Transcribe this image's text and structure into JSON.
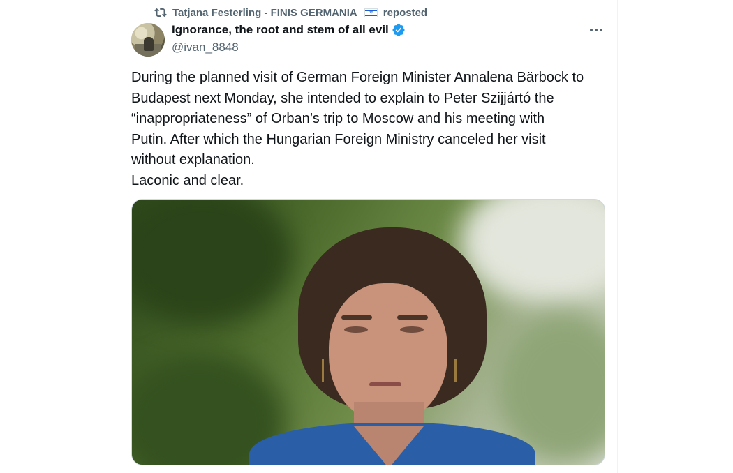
{
  "repost": {
    "user": "Tatjana Festerling - FINIS GERMANIA",
    "flag": "🇮🇱",
    "label": "reposted"
  },
  "tweet": {
    "author_name": "Ignorance, the root and stem of all evil",
    "handle": "@ivan_8848",
    "verified": true,
    "text": "During the planned visit of German Foreign Minister Annalena Bärbock to\nBudapest next Monday, she intended to explain to Peter Szijjártó the\n“inappropriateness” of Orban’s trip to Moscow and his meeting with\nPutin. After which the Hungarian Foreign Ministry canceled her visit\nwithout explanation.\nLaconic and clear."
  },
  "icons": {
    "repost": "repost-icon",
    "verified": "verified-badge-icon",
    "more": "more-options-icon"
  },
  "colors": {
    "verified_blue": "#1d9bf0",
    "secondary_text": "#536471",
    "primary_text": "#0f1419"
  }
}
